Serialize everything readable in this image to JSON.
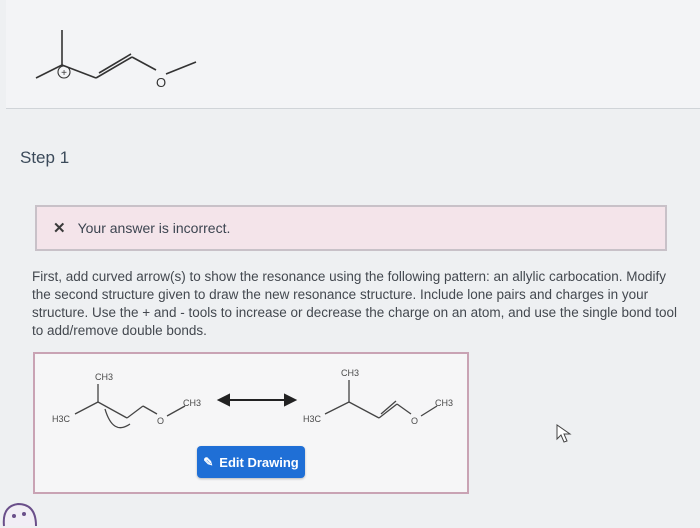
{
  "top_molecule": {
    "oxygen_label": "O",
    "charge_symbol": "+"
  },
  "step": {
    "title": "Step 1"
  },
  "feedback": {
    "icon": "x-icon",
    "message": "Your answer is incorrect."
  },
  "instructions": {
    "text": "First, add curved arrow(s) to show the resonance using the following pattern: an allylic carbocation. Modify the second structure given to draw the new resonance structure. Include lone pairs and charges in your structure. Use the + and - tools to increase or decrease the charge on an atom, and use the single bond tool to add/remove double bonds."
  },
  "drawing": {
    "left_structure": {
      "ch3_top": "CH3",
      "ch3_right": "CH3",
      "h3c_left": "H3C",
      "oxygen": "O"
    },
    "right_structure": {
      "ch3_top": "CH3",
      "ch3_right": "CH3",
      "h3c_left": "H3C",
      "oxygen": "O"
    },
    "edit_button_label": "Edit Drawing"
  },
  "colors": {
    "button": "#1f6fd6",
    "feedback_bg": "#f4e4ea",
    "drawing_border": "#c9a3b4"
  }
}
